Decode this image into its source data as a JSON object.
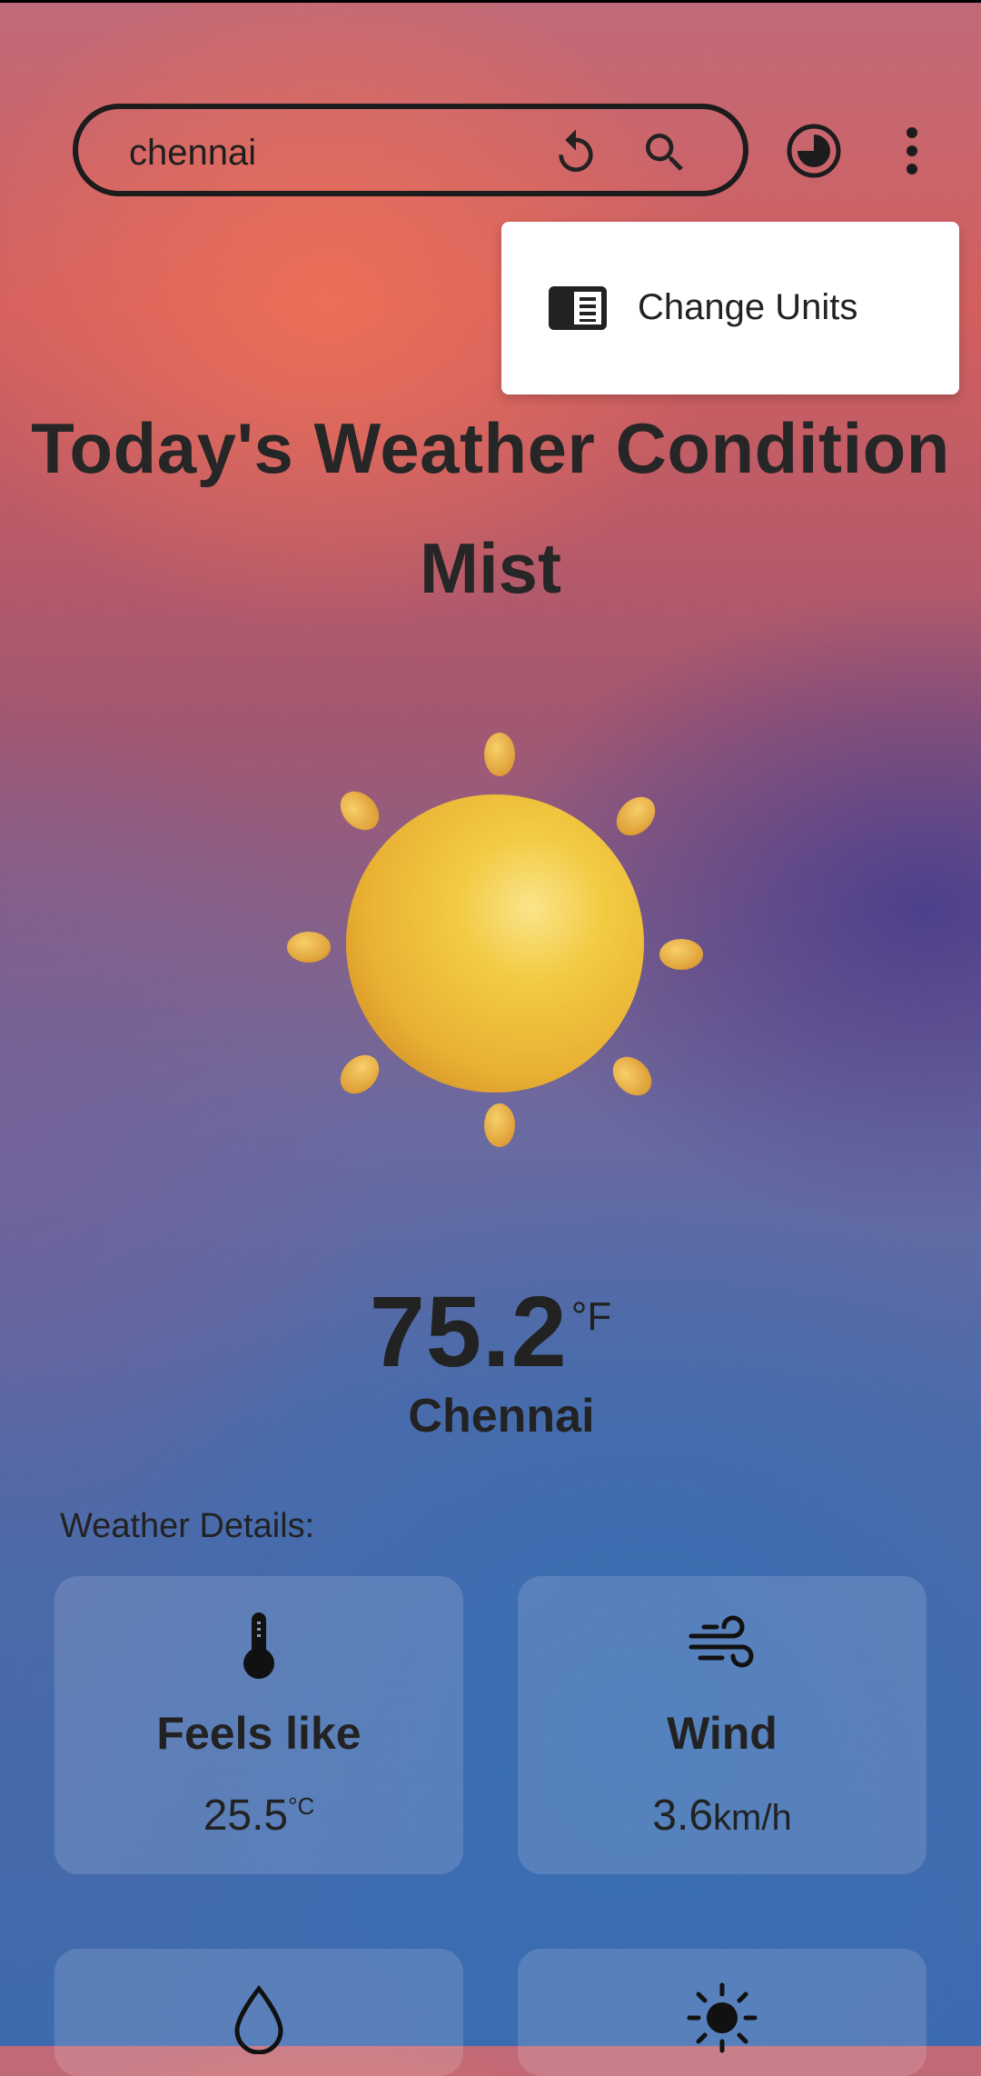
{
  "search": {
    "value": "chennai"
  },
  "menu": {
    "items": [
      {
        "label": "Change Units",
        "icon": "view-list-icon"
      }
    ]
  },
  "header": {
    "title": "Today's Weather Condition",
    "condition": "Mist"
  },
  "weather_icon": "sun-icon",
  "current": {
    "temperature": "75.2",
    "unit": "°F",
    "city": "Chennai"
  },
  "details": {
    "heading": "Weather Details:",
    "cards": [
      {
        "label": "Feels like",
        "value": "25.5",
        "unit": "°C",
        "icon": "thermometer-icon"
      },
      {
        "label": "Wind",
        "value": "3.6",
        "unit": "km/h",
        "icon": "wind-icon"
      },
      {
        "icon": "water-drop-icon"
      },
      {
        "icon": "sun-icon"
      }
    ]
  },
  "colors": {
    "text": "#222222",
    "menu_bg": "#ffffff",
    "sun": "#f2c63a",
    "sun_ray": "#eeb54a"
  }
}
